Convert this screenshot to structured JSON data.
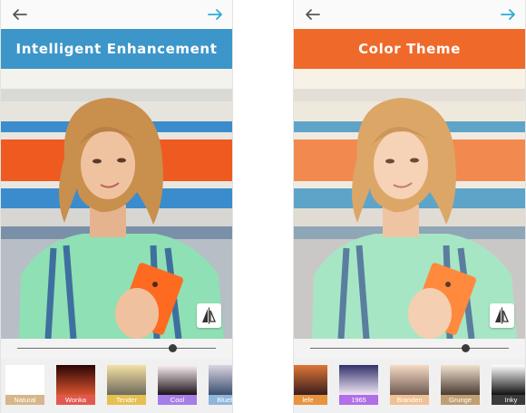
{
  "screens": [
    {
      "title": "Intelligent Enhancement",
      "banner_color": "#3d96c9",
      "slider_value": 0.78,
      "filters": [
        {
          "label": "Natural",
          "label_color": "#d7b68b",
          "swatch": [
            "#ffffff",
            "#ffffff"
          ]
        },
        {
          "label": "Wonka",
          "label_color": "#e2584f",
          "swatch": [
            "#2a0505",
            "#d9542f"
          ]
        },
        {
          "label": "Tender",
          "label_color": "#e6c051",
          "swatch": [
            "#f5e1a4",
            "#6e6a5c"
          ]
        },
        {
          "label": "Cool",
          "label_color": "#a57fe6",
          "swatch": [
            "#fbf1f4",
            "#1c1118"
          ]
        },
        {
          "label": "BlueDa",
          "label_color": "#8fb6dc",
          "swatch": [
            "#dcd4e2",
            "#3a4f6e"
          ]
        }
      ]
    },
    {
      "title": "Color Theme",
      "banner_color": "#ef6a2a",
      "slider_value": 0.78,
      "filters": [
        {
          "label": "lefe",
          "label_color": "#e8943f",
          "swatch": [
            "#df7636",
            "#3a1e1e"
          ]
        },
        {
          "label": "1965",
          "label_color": "#b06ee8",
          "swatch": [
            "#31316b",
            "#f3e8f6"
          ]
        },
        {
          "label": "Branden",
          "label_color": "#f0c193",
          "swatch": [
            "#f6dcc5",
            "#6e5a50"
          ]
        },
        {
          "label": "Grunge",
          "label_color": "#bf9f73",
          "swatch": [
            "#f1e2cf",
            "#4a3b33"
          ]
        },
        {
          "label": "Inky",
          "label_color": "#3b3b3b",
          "swatch": [
            "#ffffff",
            "#101010"
          ]
        }
      ]
    }
  ],
  "icons": {
    "back": "arrow-left-icon",
    "next": "arrow-right-icon",
    "compare": "compare-split-icon"
  }
}
